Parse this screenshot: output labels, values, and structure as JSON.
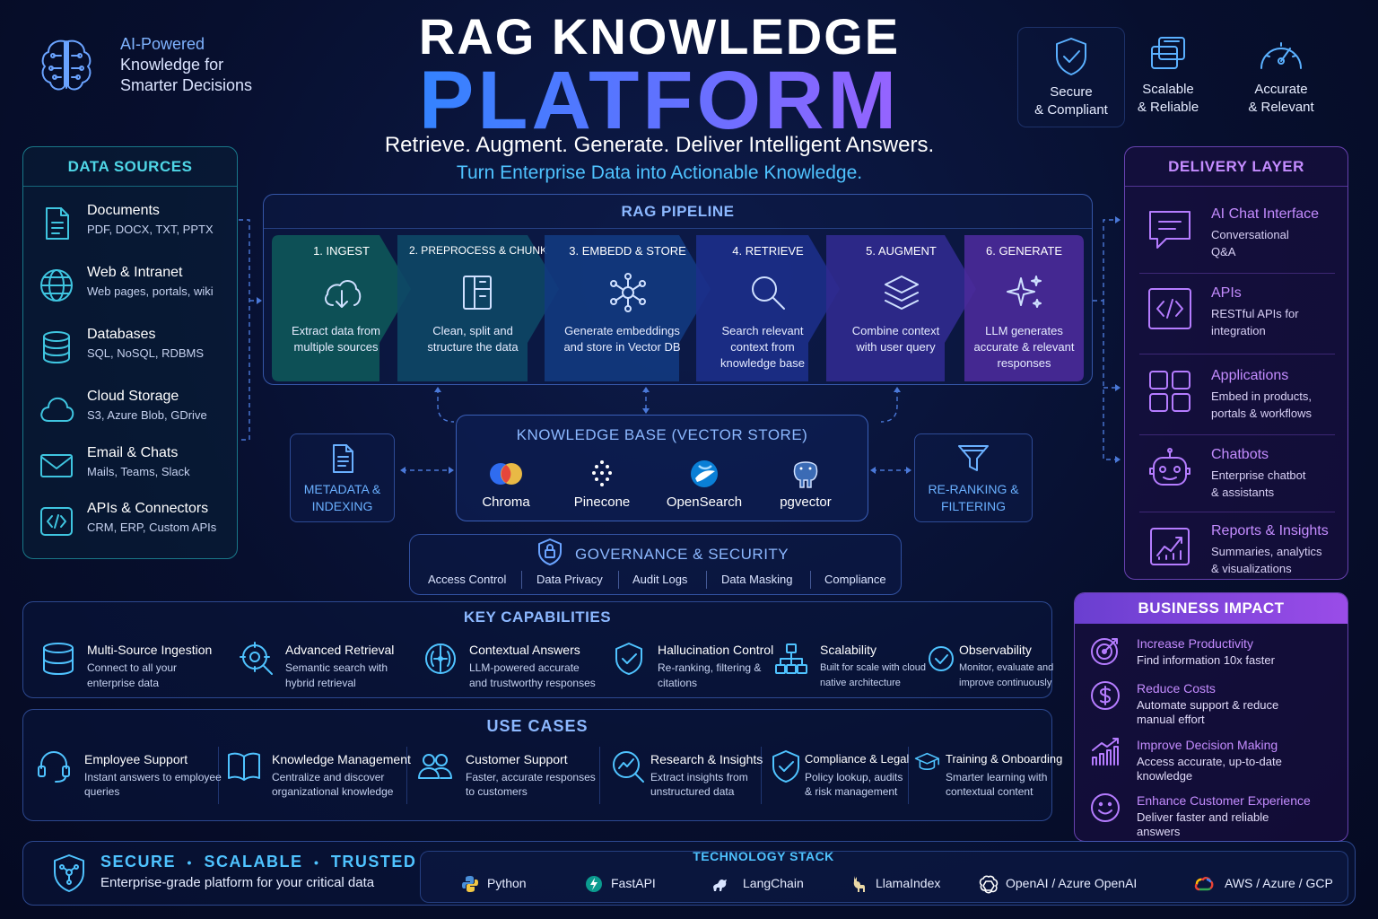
{
  "header": {
    "tagline": [
      "AI-Powered",
      "Knowledge for",
      "Smarter Decisions"
    ],
    "title_line1": "RAG KNOWLEDGE",
    "title_line2": "PLATFORM",
    "subtitle": "Retrieve. Augment. Generate. Deliver Intelligent Answers.",
    "subtitle2": "Turn Enterprise Data into Actionable Knowledge.",
    "badges": [
      {
        "label": [
          "Secure",
          "& Compliant"
        ],
        "icon": "shield-check-icon"
      },
      {
        "label": [
          "Scalable",
          "& Reliable"
        ],
        "icon": "stacked-cards-icon"
      },
      {
        "label": [
          "Accurate",
          "& Relevant"
        ],
        "icon": "gauge-icon"
      }
    ]
  },
  "data_sources": {
    "title": "DATA SOURCES",
    "items": [
      {
        "title": "Documents",
        "desc": "PDF, DOCX, TXT, PPTX",
        "icon": "document-icon"
      },
      {
        "title": "Web & Intranet",
        "desc": "Web pages, portals, wiki",
        "icon": "globe-icon"
      },
      {
        "title": "Databases",
        "desc": "SQL, NoSQL, RDBMS",
        "icon": "database-icon"
      },
      {
        "title": "Cloud Storage",
        "desc": "S3, Azure Blob, GDrive",
        "icon": "cloud-icon"
      },
      {
        "title": "Email & Chats",
        "desc": "Mails, Teams, Slack",
        "icon": "mail-icon"
      },
      {
        "title": "APIs & Connectors",
        "desc": "CRM, ERP, Custom APIs",
        "icon": "code-icon"
      }
    ]
  },
  "pipeline": {
    "title": "RAG PIPELINE",
    "stages": [
      {
        "name": "1. INGEST",
        "desc": [
          "Extract data from",
          "multiple sources"
        ],
        "icon": "cloud-download-icon",
        "color": "#0e5a5a"
      },
      {
        "name": "2. PREPROCESS & CHUNK",
        "desc": [
          "Clean, split and",
          "structure the data"
        ],
        "icon": "split-doc-icon",
        "color": "#0d4766"
      },
      {
        "name": "3. EMBEDD & STORE",
        "desc": [
          "Generate embeddings",
          "and store in Vector DB"
        ],
        "icon": "neural-net-icon",
        "color": "#123a80"
      },
      {
        "name": "4. RETRIEVE",
        "desc": [
          "Search relevant",
          "context from",
          "knowledge base"
        ],
        "icon": "search-icon",
        "color": "#1c2f8a"
      },
      {
        "name": "5. AUGMENT",
        "desc": [
          "Combine context",
          "with user query"
        ],
        "icon": "layers-icon",
        "color": "#302a8f"
      },
      {
        "name": "6. GENERATE",
        "desc": [
          "LLM generates",
          "accurate & relevant",
          "responses"
        ],
        "icon": "sparkle-icon",
        "color": "#4a2a9a"
      }
    ]
  },
  "knowledge_base": {
    "title": "KNOWLEDGE BASE (VECTOR STORE)",
    "stores": [
      {
        "name": "Chroma",
        "icon": "chroma-logo-icon"
      },
      {
        "name": "Pinecone",
        "icon": "pinecone-logo-icon"
      },
      {
        "name": "OpenSearch",
        "icon": "opensearch-logo-icon"
      },
      {
        "name": "pgvector",
        "icon": "postgres-elephant-icon"
      }
    ]
  },
  "metadata_box": {
    "label": [
      "METADATA &",
      "INDEXING"
    ],
    "icon": "document-list-icon"
  },
  "reranking_box": {
    "label": [
      "RE-RANKING &",
      "FILTERING"
    ],
    "icon": "funnel-icon"
  },
  "governance": {
    "title": "GOVERNANCE & SECURITY",
    "items": [
      "Access Control",
      "Data Privacy",
      "Audit Logs",
      "Data Masking",
      "Compliance"
    ]
  },
  "delivery_layer": {
    "title": "DELIVERY LAYER",
    "items": [
      {
        "title": "AI Chat Interface",
        "desc": [
          "Conversational",
          "Q&A"
        ],
        "icon": "chat-bubble-icon"
      },
      {
        "title": "APIs",
        "desc": [
          "RESTful APIs for",
          "integration"
        ],
        "icon": "code-window-icon"
      },
      {
        "title": "Applications",
        "desc": [
          "Embed in products,",
          "portals & workflows"
        ],
        "icon": "app-grid-icon"
      },
      {
        "title": "Chatbots",
        "desc": [
          "Enterprise chatbot",
          "& assistants"
        ],
        "icon": "robot-icon"
      },
      {
        "title": "Reports & Insights",
        "desc": [
          "Summaries, analytics",
          "& visualizations"
        ],
        "icon": "chart-up-icon"
      }
    ]
  },
  "key_capabilities": {
    "title": "KEY CAPABILITIES",
    "items": [
      {
        "title": "Multi-Source Ingestion",
        "desc": [
          "Connect to all your",
          "enterprise data"
        ],
        "icon": "database-stack-icon"
      },
      {
        "title": "Advanced Retrieval",
        "desc": [
          "Semantic search with",
          "hybrid retrieval"
        ],
        "icon": "target-search-icon"
      },
      {
        "title": "Contextual Answers",
        "desc": [
          "LLM-powered accurate",
          "and trustworthy responses"
        ],
        "icon": "brain-chip-icon"
      },
      {
        "title": "Hallucination Control",
        "desc": [
          "Re-ranking, filtering &",
          "citations"
        ],
        "icon": "shield-check-icon"
      },
      {
        "title": "Scalability",
        "desc": [
          "Built for scale with cloud",
          "native architecture"
        ],
        "icon": "hierarchy-icon"
      },
      {
        "title": "Observability",
        "desc": [
          "Monitor, evaluate and",
          "improve continuously"
        ],
        "icon": "check-circle-icon"
      }
    ]
  },
  "use_cases": {
    "title": "USE CASES",
    "items": [
      {
        "title": "Employee Support",
        "desc": [
          "Instant answers to employee",
          "queries"
        ],
        "icon": "headset-icon"
      },
      {
        "title": "Knowledge Management",
        "desc": [
          "Centralize and discover",
          "organizational knowledge"
        ],
        "icon": "open-book-icon"
      },
      {
        "title": "Customer Support",
        "desc": [
          "Faster, accurate responses",
          "to customers"
        ],
        "icon": "users-icon"
      },
      {
        "title": "Research & Insights",
        "desc": [
          "Extract insights from",
          "unstructured data"
        ],
        "icon": "analytics-search-icon"
      },
      {
        "title": "Compliance & Legal",
        "desc": [
          "Policy lookup, audits",
          "& risk management"
        ],
        "icon": "shield-check-icon"
      },
      {
        "title": "Training & Onboarding",
        "desc": [
          "Smarter learning with",
          "contextual content"
        ],
        "icon": "graduation-cap-icon"
      }
    ]
  },
  "business_impact": {
    "title": "BUSINESS IMPACT",
    "items": [
      {
        "title": "Increase Productivity",
        "desc": [
          "Find information 10x faster"
        ],
        "icon": "target-icon"
      },
      {
        "title": "Reduce Costs",
        "desc": [
          "Automate support & reduce",
          "manual effort"
        ],
        "icon": "dollar-icon"
      },
      {
        "title": "Improve Decision Making",
        "desc": [
          "Access accurate, up-to-date",
          "knowledge"
        ],
        "icon": "bar-growth-icon"
      },
      {
        "title": "Enhance Customer Experience",
        "desc": [
          "Deliver faster and reliable",
          "answers"
        ],
        "icon": "smiley-icon"
      }
    ]
  },
  "footer": {
    "trust": [
      "SECURE",
      "SCALABLE",
      "TRUSTED"
    ],
    "trust_sep": "•",
    "trust_sub": "Enterprise-grade platform for your critical data",
    "tech_title": "TECHNOLOGY STACK",
    "tech": [
      {
        "name": "Python",
        "icon": "python-logo-icon"
      },
      {
        "name": "FastAPI",
        "icon": "fastapi-logo-icon"
      },
      {
        "name": "LangChain",
        "icon": "langchain-logo-icon"
      },
      {
        "name": "LlamaIndex",
        "icon": "llama-logo-icon"
      },
      {
        "name": "OpenAI / Azure OpenAI",
        "icon": "openai-logo-icon"
      },
      {
        "name": "AWS / Azure / GCP",
        "icon": "cloud-multi-logo-icon"
      }
    ]
  }
}
